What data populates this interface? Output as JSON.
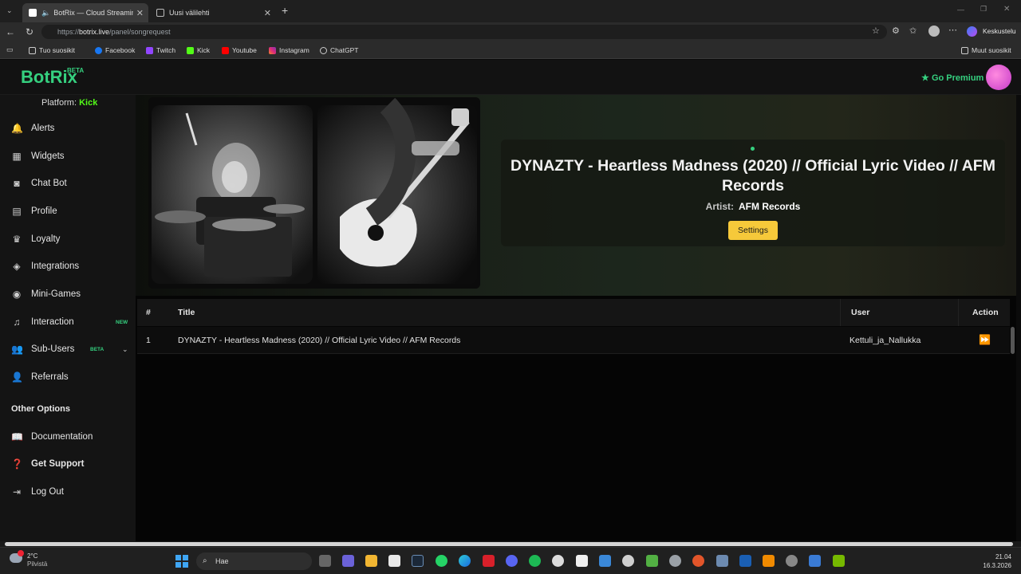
{
  "browser": {
    "tabs": [
      {
        "title": "BotRix — Cloud Streaming Bot",
        "active": true
      },
      {
        "title": "Uusi välilehti",
        "active": false
      }
    ],
    "url_prefix": "https://",
    "url_host": "botrix.live",
    "url_path": "/panel/songrequest",
    "profile_label": "Keskustelu",
    "bookmarks": [
      "Tuo suosikit",
      "Facebook",
      "Twitch",
      "Kick",
      "Youtube",
      "Instagram",
      "ChatGPT"
    ],
    "other_bookmarks": "Muut suosikit"
  },
  "app": {
    "logo": "BotRix",
    "logo_badge": "BETA",
    "premium_label": "Go Premium",
    "platform_label": "Platform:",
    "platform_value": "Kick"
  },
  "sidebar": {
    "items": [
      {
        "label": "Alerts",
        "icon": "bell-icon"
      },
      {
        "label": "Widgets",
        "icon": "grid-icon"
      },
      {
        "label": "Chat Bot",
        "icon": "robot-icon"
      },
      {
        "label": "Profile",
        "icon": "id-card-icon"
      },
      {
        "label": "Loyalty",
        "icon": "trophy-icon"
      },
      {
        "label": "Integrations",
        "icon": "cubes-icon"
      },
      {
        "label": "Mini-Games",
        "icon": "gamepad-icon"
      },
      {
        "label": "Interaction",
        "icon": "music-icon",
        "badge": "NEW"
      },
      {
        "label": "Sub-Users",
        "icon": "users-icon",
        "badge": "BETA"
      },
      {
        "label": "Referrals",
        "icon": "user-plus-icon"
      }
    ],
    "other_heading": "Other Options",
    "other_items": [
      {
        "label": "Documentation",
        "icon": "book-icon"
      },
      {
        "label": "Get Support",
        "icon": "question-icon"
      },
      {
        "label": "Log Out",
        "icon": "logout-icon"
      }
    ]
  },
  "now_playing": {
    "title": "DYNAZTY - Heartless Madness (2020) // Official Lyric Video // AFM Records",
    "artist_label": "Artist:",
    "artist": "AFM Records",
    "settings_label": "Settings"
  },
  "queue": {
    "columns": [
      "#",
      "Title",
      "User",
      "Action"
    ],
    "rows": [
      {
        "num": "1",
        "title": "DYNAZTY - Heartless Madness (2020) // Official Lyric Video // AFM Records",
        "user": "Kettuli_ja_Nallukka"
      }
    ]
  },
  "taskbar": {
    "weather_temp": "2°C",
    "weather_cond": "Pilvistä",
    "search_placeholder": "Hae",
    "time": "21.04",
    "date": "16.3.2026"
  },
  "colors": {
    "accent": "#35d07f",
    "kick": "#53fc18",
    "settings_button": "#f6c93a"
  }
}
